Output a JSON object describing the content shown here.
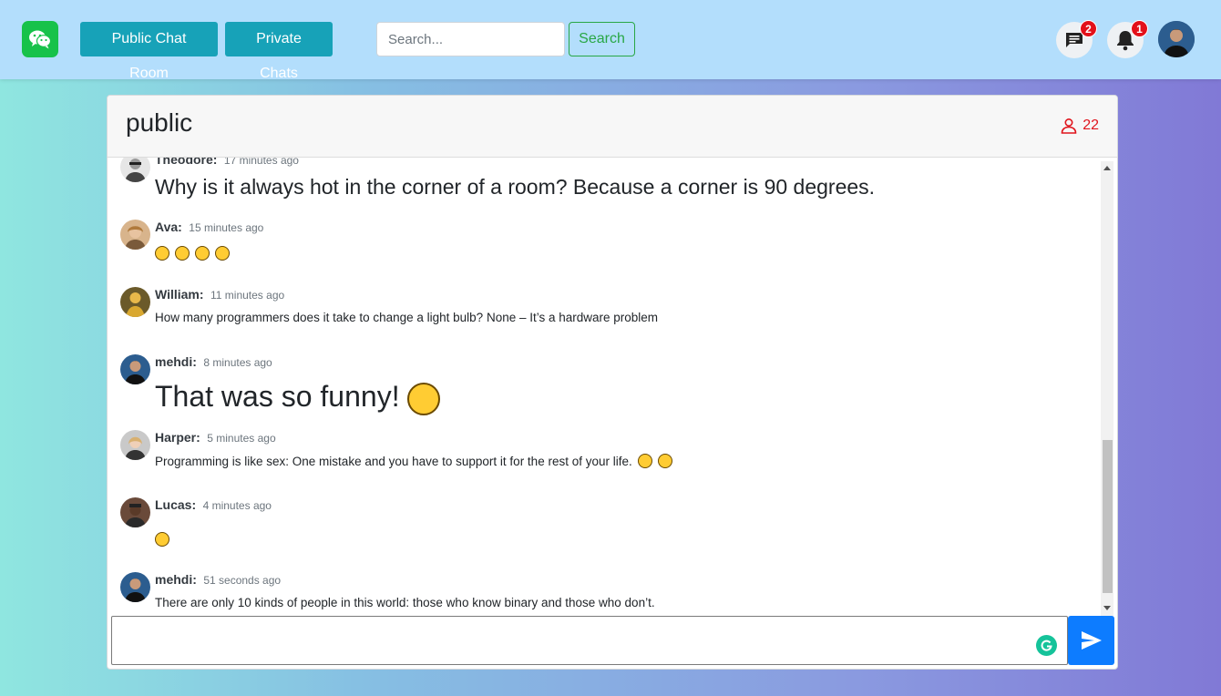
{
  "navbar": {
    "logo_icon": "wechat-icon",
    "public_chat_label": "Public Chat Room",
    "private_chats_label": "Private Chats",
    "search_placeholder": "Search...",
    "search_button_label": "Search",
    "messages_badge": "2",
    "notifications_badge": "1",
    "accent_color": "#17a2b8",
    "navbar_color": "#b3defc"
  },
  "room": {
    "title": "public",
    "member_count": "22",
    "member_icon": "user-icon",
    "member_color": "#e0151d"
  },
  "messages": [
    {
      "sender": "Theodore:",
      "time": "17 minutes ago",
      "text": "Why is it always hot in the corner of a room? Because a corner is 90 degrees."
    },
    {
      "sender": "Ava:",
      "time": "15 minutes ago",
      "text": "",
      "emojis": [
        "laughing-emoji",
        "grinning-emoji",
        "joy-emoji",
        "rofl-emoji"
      ]
    },
    {
      "sender": "William:",
      "time": "11 minutes ago",
      "text": "How many programmers does it take to change a light bulb? None – It’s a hardware problem"
    },
    {
      "sender": "mehdi:",
      "time": "8 minutes ago",
      "text": "That was so funny!",
      "emojis": [
        "grinning-emoji"
      ]
    },
    {
      "sender": "Harper:",
      "time": "5 minutes ago",
      "text": "Programming is like sex: One mistake and you have to support it for the rest of your life.",
      "emojis": [
        "scream-emoji",
        "fearful-emoji"
      ]
    },
    {
      "sender": "Lucas:",
      "time": "4 minutes ago",
      "text": "",
      "emojis": [
        "joy-emoji"
      ]
    },
    {
      "sender": "mehdi:",
      "time": "51 seconds ago",
      "text": "There are only 10 kinds of people in this world: those who know binary and those who don’t."
    }
  ],
  "composer": {
    "value": "",
    "send_icon": "send-icon",
    "grammarly_icon": "grammarly-icon",
    "send_color": "#0d7cff"
  }
}
